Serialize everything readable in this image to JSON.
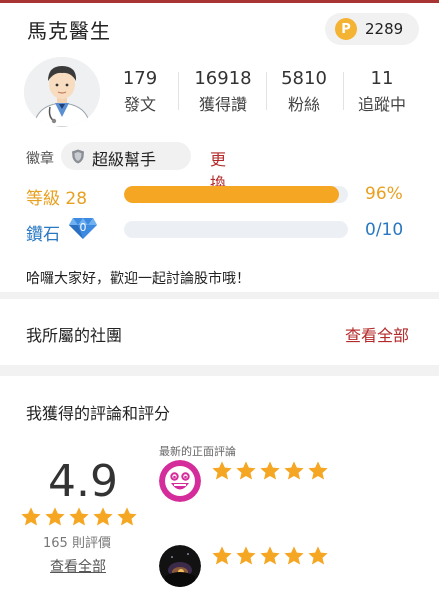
{
  "profile": {
    "name": "馬克醫生",
    "coins": "2289",
    "coin_symbol": "P"
  },
  "stats": [
    {
      "value": "179",
      "label": "發文"
    },
    {
      "value": "16918",
      "label": "獲得讚"
    },
    {
      "value": "5810",
      "label": "粉絲"
    },
    {
      "value": "11",
      "label": "追蹤中"
    }
  ],
  "badge": {
    "label": "徽章",
    "name": "超級幫手",
    "change": "更換"
  },
  "level": {
    "label": "等級 28",
    "percent_text": "96%",
    "percent": 96
  },
  "diamond": {
    "label": "鑽石",
    "count": "0",
    "value_text": "0/10",
    "percent": 0
  },
  "bio": "哈囉大家好，歡迎一起討論股市哦！",
  "club": {
    "title": "我所屬的社團",
    "link": "查看全部"
  },
  "reviews": {
    "title": "我獲得的評論和評分",
    "score": "4.9",
    "count_text": "165 則評價",
    "view_all": "查看全部",
    "latest_label": "最新的正面評論",
    "items": [
      {
        "stars": 5
      },
      {
        "stars": 5
      }
    ],
    "overall_stars": 5
  },
  "colors": {
    "accent_red": "#b42a2a",
    "level_orange": "#f5a623",
    "diamond_blue": "#2a78c2",
    "star_gold": "#f5a623"
  },
  "icons": {
    "coin": "coin-icon",
    "shield": "shield-icon",
    "diamond": "diamond-icon",
    "star": "star-icon"
  }
}
